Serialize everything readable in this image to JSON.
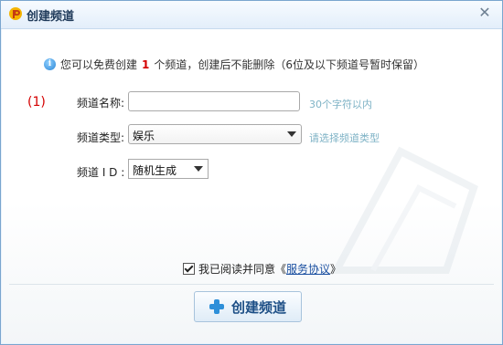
{
  "window": {
    "title": "创建频道",
    "close_symbol": "✕"
  },
  "notice": {
    "prefix": "您可以免费创建",
    "count": "1",
    "suffix": "个频道，创建后不能删除（6位及以下频道号暂时保留）"
  },
  "form": {
    "step_label": "(1)",
    "name": {
      "label": "频道名称:",
      "value": "",
      "hint": "30个字符以内"
    },
    "type": {
      "label": "频道类型:",
      "selected": "娱乐",
      "hint": "请选择频道类型"
    },
    "id": {
      "label": "频道 I D :",
      "selected": "随机生成"
    }
  },
  "agreement": {
    "checked": true,
    "text_before": "我已阅读并同意《",
    "link_text": "服务协议",
    "text_after": "》"
  },
  "create_button": {
    "label": "创建频道"
  },
  "icons": {
    "app": "app-logo-icon",
    "info": "info-icon",
    "close": "close-icon",
    "plus": "plus-icon"
  },
  "colors": {
    "accent": "#2d8fd9",
    "warning_red": "#d40000",
    "hint": "#7fb3c6",
    "link": "#1a4fa0"
  }
}
